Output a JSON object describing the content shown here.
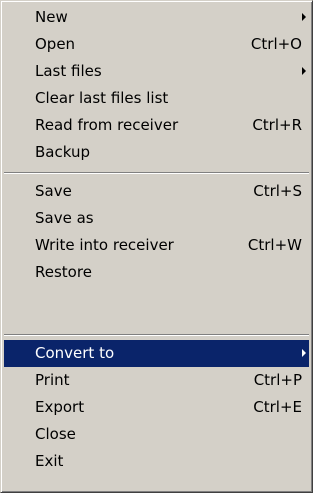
{
  "menu": {
    "selected_color": "#0a246a",
    "items": [
      {
        "label": "New",
        "shortcut": "",
        "submenu": true
      },
      {
        "label": "Open",
        "shortcut": "Ctrl+O",
        "submenu": false
      },
      {
        "label": "Last files",
        "shortcut": "",
        "submenu": true
      },
      {
        "label": "Clear last files list",
        "shortcut": "",
        "submenu": false
      },
      {
        "label": "Read from receiver",
        "shortcut": "Ctrl+R",
        "submenu": false
      },
      {
        "label": "Backup",
        "shortcut": "",
        "submenu": false
      },
      {
        "label": "Save",
        "shortcut": "Ctrl+S",
        "submenu": false
      },
      {
        "label": "Save as",
        "shortcut": "",
        "submenu": false
      },
      {
        "label": "Write into receiver",
        "shortcut": "Ctrl+W",
        "submenu": false
      },
      {
        "label": "Restore",
        "shortcut": "",
        "submenu": false
      },
      {
        "label": "Convert to",
        "shortcut": "",
        "submenu": true,
        "selected": true
      },
      {
        "label": "Print",
        "shortcut": "Ctrl+P",
        "submenu": false
      },
      {
        "label": "Export",
        "shortcut": "Ctrl+E",
        "submenu": false
      },
      {
        "label": "Close",
        "shortcut": "",
        "submenu": false
      },
      {
        "label": "Exit",
        "shortcut": "",
        "submenu": false
      }
    ]
  }
}
